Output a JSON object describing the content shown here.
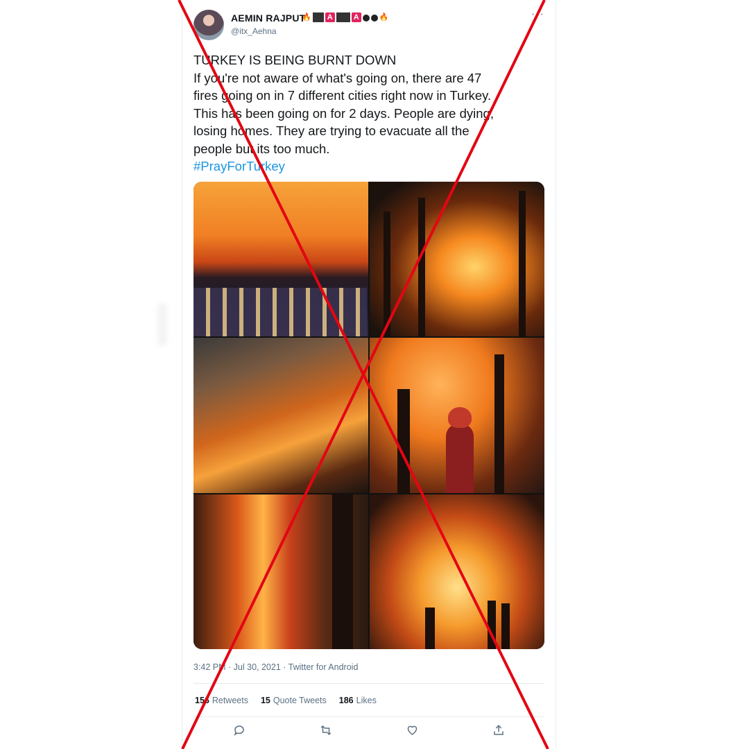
{
  "user": {
    "name": "AEMIN RAJPUT",
    "handle": "@itx_Aehna",
    "badge_letter": "A"
  },
  "menu_icon": "more-icon",
  "tweet": {
    "lines": [
      "TURKEY IS BEING BURNT DOWN",
      "If you're not aware of what's going on, there are 47",
      "fires going on in 7 different cities right now in Turkey.",
      "This has been going on for 2 days. People are dying,",
      "losing homes. They are trying to evacuate all the",
      "people but its too much."
    ],
    "hashtag": "#PrayForTurkey"
  },
  "media": {
    "count": 6
  },
  "meta": {
    "timestamp": "3:42 PM · Jul 30, 2021 · Twitter for Android"
  },
  "stats": [
    {
      "count": "156",
      "label": "Retweets"
    },
    {
      "count": "15",
      "label": "Quote Tweets"
    },
    {
      "count": "186",
      "label": "Likes"
    }
  ],
  "actions": [
    "reply-icon",
    "retweet-icon",
    "like-icon",
    "share-icon"
  ],
  "overlay": {
    "color": "#e00000"
  }
}
